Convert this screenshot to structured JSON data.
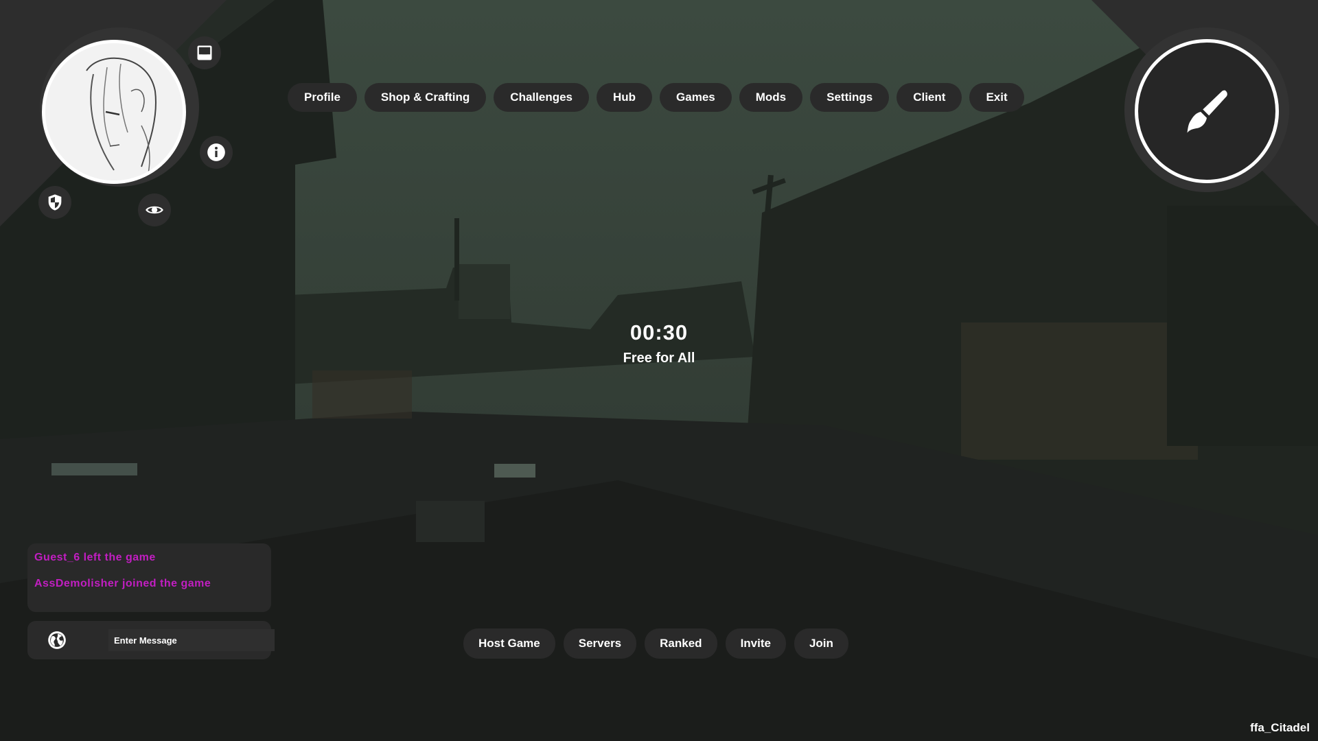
{
  "nav": {
    "items": [
      {
        "label": "Profile",
        "name": "nav-profile"
      },
      {
        "label": "Shop & Crafting",
        "name": "nav-shop-crafting"
      },
      {
        "label": "Challenges",
        "name": "nav-challenges"
      },
      {
        "label": "Hub",
        "name": "nav-hub"
      },
      {
        "label": "Games",
        "name": "nav-games"
      },
      {
        "label": "Mods",
        "name": "nav-mods"
      },
      {
        "label": "Settings",
        "name": "nav-settings"
      },
      {
        "label": "Client",
        "name": "nav-client"
      },
      {
        "label": "Exit",
        "name": "nav-exit"
      }
    ]
  },
  "profile": {
    "icons": [
      "inbox-icon",
      "info-icon",
      "shield-icon",
      "eye-icon"
    ]
  },
  "customize": {
    "icon": "paint-brush-icon"
  },
  "match": {
    "timer": "00:30",
    "mode": "Free for All",
    "map": "ffa_Citadel"
  },
  "chat": {
    "messages": [
      "Guest_6 left the game",
      "AssDemolisher joined the game"
    ],
    "message_color": "#c21ec2",
    "input_placeholder": "Enter Message",
    "globe_icon": "globe-icon"
  },
  "actions": {
    "items": [
      {
        "label": "Host Game",
        "name": "host-game-button"
      },
      {
        "label": "Servers",
        "name": "servers-button"
      },
      {
        "label": "Ranked",
        "name": "ranked-button"
      },
      {
        "label": "Invite",
        "name": "invite-button"
      },
      {
        "label": "Join",
        "name": "join-button"
      }
    ]
  }
}
